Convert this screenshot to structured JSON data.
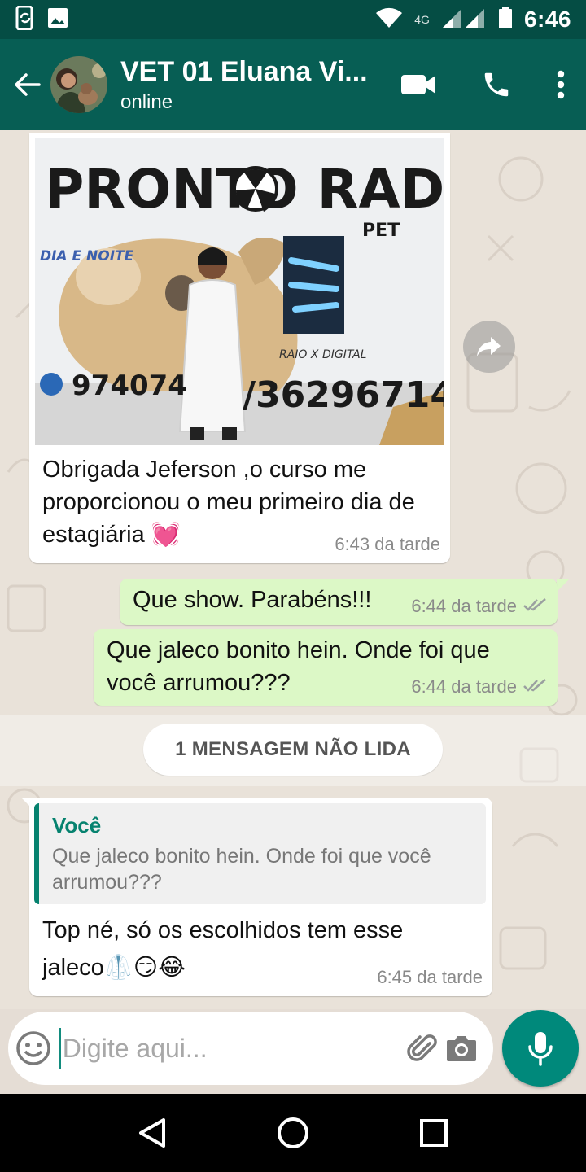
{
  "status_bar": {
    "time": "6:46",
    "network": "4G",
    "icons": [
      "sync-phone-icon",
      "gallery-icon",
      "wifi-icon",
      "signal-icon",
      "battery-icon"
    ]
  },
  "header": {
    "contact_name": "VET 01 Eluana Vi...",
    "status": "online",
    "icons": [
      "back-arrow-icon",
      "video-call-icon",
      "phone-icon",
      "more-vert-icon"
    ]
  },
  "messages": [
    {
      "direction": "incoming",
      "type": "image",
      "image_text": {
        "sign_title": "PRONTO RAD",
        "sign_sub": "PET",
        "sign_left": "DIA E NOITE",
        "sign_badge": "RAIO X DIGITAL",
        "sign_phone_left": "974074",
        "sign_phone_right": "/36296714"
      },
      "caption": "Obrigada Jeferson ,o curso me proporcionou o meu primeiro dia de estagiária 💓",
      "time": "6:43 da tarde"
    },
    {
      "direction": "outgoing",
      "text": "Que show. Parabéns!!!",
      "time": "6:44 da tarde",
      "ticks": "✓✓"
    },
    {
      "direction": "outgoing",
      "text": "Que jaleco bonito hein. Onde foi que você arrumou???",
      "time": "6:44 da tarde",
      "ticks": "✓✓"
    },
    {
      "direction": "incoming",
      "reply_to": {
        "author": "Você",
        "text": "Que jaleco bonito hein. Onde foi que você arrumou???"
      },
      "text": "Top né, só os escolhidos tem esse jaleco🥼😏😂",
      "time": "6:45 da tarde"
    }
  ],
  "unread_banner": "1 MENSAGEM NÃO LIDA",
  "composer": {
    "placeholder": "Digite aqui...",
    "icons": [
      "emoji-icon",
      "attach-icon",
      "camera-icon",
      "mic-icon"
    ]
  },
  "nav": {
    "icons": [
      "nav-back-icon",
      "nav-home-icon",
      "nav-recents-icon"
    ]
  },
  "colors": {
    "status_bar": "#054d44",
    "app_bar": "#075e54",
    "outgoing_bubble": "#dcf8c6",
    "accent": "#00897b",
    "chat_bg": "#e9e2d9"
  }
}
